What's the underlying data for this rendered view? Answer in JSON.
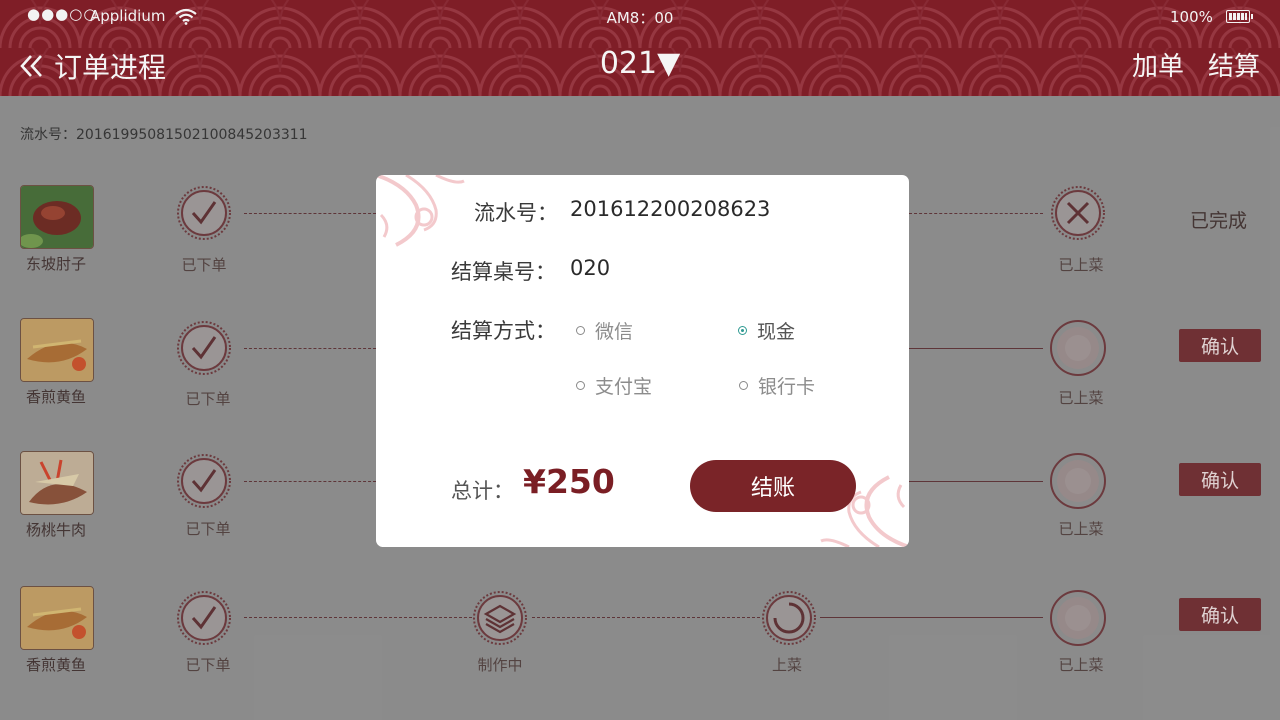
{
  "status_bar": {
    "signal": "●●●○○",
    "carrier": "Applidium",
    "time": "AM8：00",
    "battery_pct": "100%"
  },
  "nav": {
    "back_label": "订单进程",
    "table_number": "021▼",
    "add_order_label": "加单",
    "checkout_label": "结算"
  },
  "order_serial": "流水号：20161995081502100845203311",
  "rows": [
    {
      "dish": "东坡肘子",
      "step1": "已下单",
      "step4": "已上菜",
      "action": "已完成"
    },
    {
      "dish": "香煎黄鱼",
      "step1": "已下单",
      "step4": "已上菜",
      "action": "确认"
    },
    {
      "dish": "杨桃牛肉",
      "step1": "已下单",
      "step4": "已上菜",
      "action": "确认"
    },
    {
      "dish": "香煎黄鱼",
      "step1": "已下单",
      "step2": "制作中",
      "step3": "上菜",
      "step4": "已上菜",
      "action": "确认"
    }
  ],
  "modal": {
    "serial_label": "流水号：",
    "serial_value": "201612200208623",
    "table_label": "结算桌号：",
    "table_value": "020",
    "method_label": "结算方式：",
    "methods": [
      {
        "label": "微信",
        "selected": false
      },
      {
        "label": "现金",
        "selected": true
      },
      {
        "label": "支付宝",
        "selected": false
      },
      {
        "label": "银行卡",
        "selected": false
      }
    ],
    "total_label": "总计：",
    "total_value": "¥250",
    "pay_button": "结账"
  },
  "colors": {
    "header": "#9b2530",
    "accent": "#7a2428",
    "selected_radio": "#2f9a92"
  }
}
